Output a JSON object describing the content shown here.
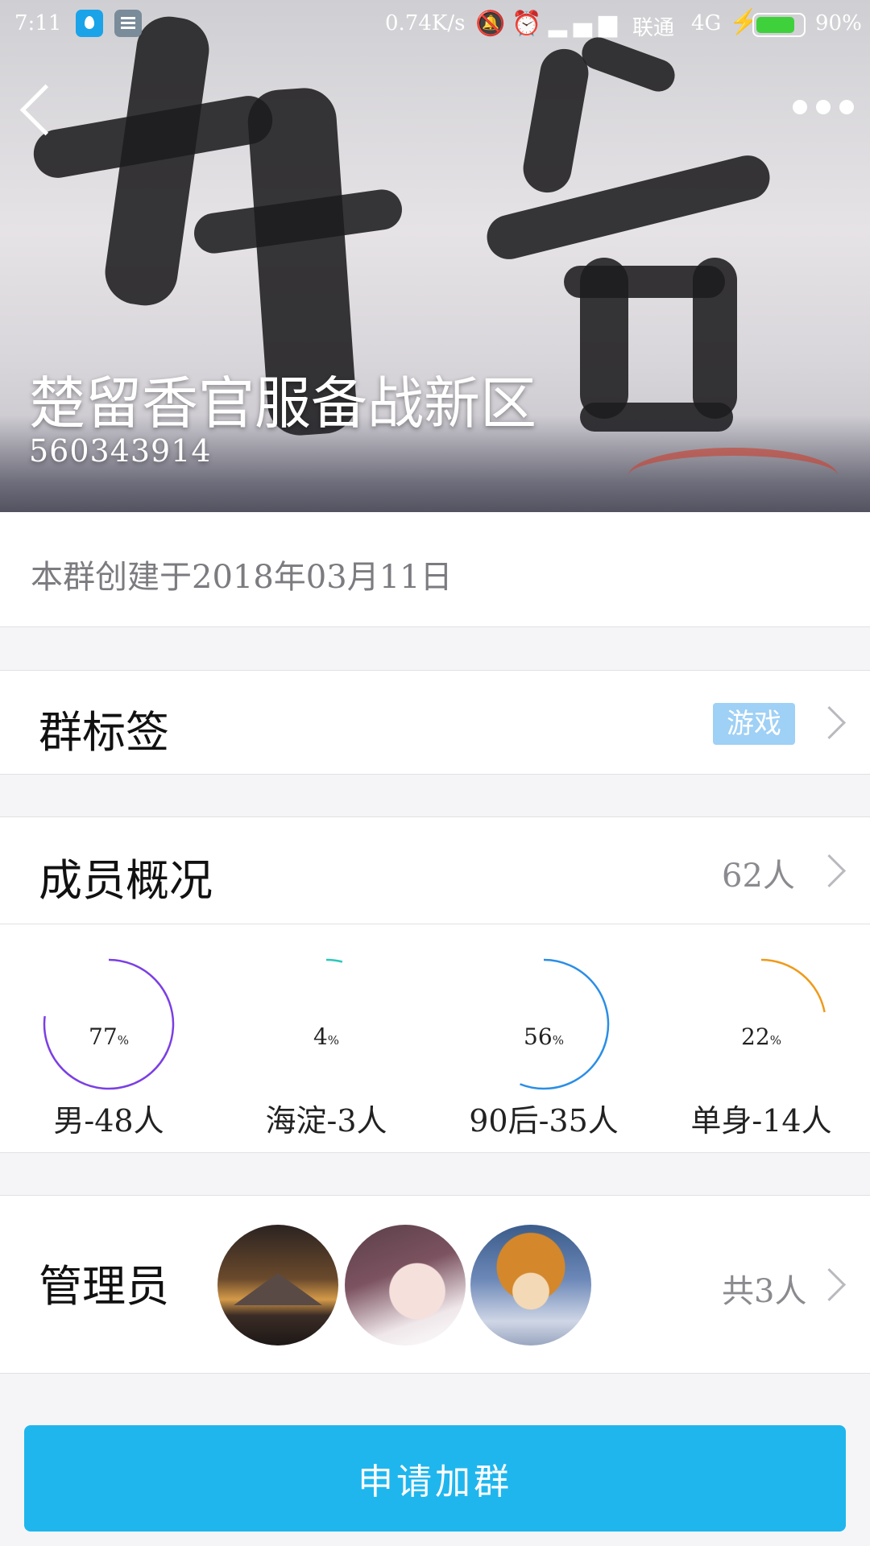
{
  "status_bar": {
    "time": "7:11",
    "net_speed": "0.74K/s",
    "carrier": "联通",
    "network": "4G",
    "battery_percent": "90%",
    "battery_level": 0.9,
    "icons": [
      "bell-off-icon",
      "alarm-icon",
      "signal-icon",
      "signal-bars-icon",
      "charging-icon"
    ]
  },
  "header": {
    "group_name": "楚留香官服备战新区",
    "group_id": "560343914"
  },
  "created": {
    "text": "本群创建于2018年03月11日"
  },
  "tags": {
    "label": "群标签",
    "tag": "游戏"
  },
  "members": {
    "label": "成员概况",
    "count": "62人",
    "stats": [
      {
        "percent": "77",
        "unit": "%",
        "label": "男-48人",
        "value": 0.77,
        "color": "#7b3fe4"
      },
      {
        "percent": "4",
        "unit": "%",
        "label": "海淀-3人",
        "value": 0.04,
        "color": "#2cc8b8"
      },
      {
        "percent": "56",
        "unit": "%",
        "label": "90后-35人",
        "value": 0.56,
        "color": "#2a8ee6"
      },
      {
        "percent": "22",
        "unit": "%",
        "label": "单身-14人",
        "value": 0.22,
        "color": "#ef9a1a"
      }
    ]
  },
  "admins": {
    "label": "管理员",
    "count": "共3人"
  },
  "join_button": "申请加群",
  "colors": {
    "accent": "#1fb6ee",
    "tag_bg": "#9fd0f5"
  }
}
